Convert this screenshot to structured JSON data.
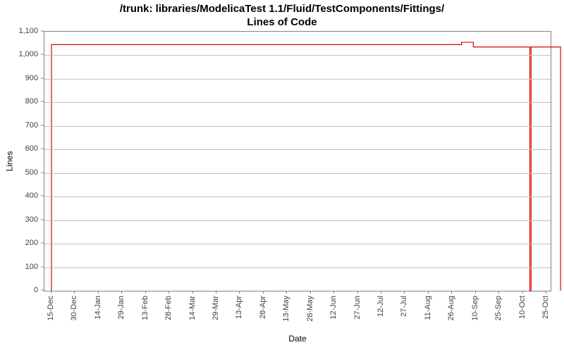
{
  "chart_data": {
    "type": "line",
    "title_line1": "/trunk: libraries/ModelicaTest 1.1/Fluid/TestComponents/Fittings/",
    "title_line2": "Lines of Code",
    "xlabel": "Date",
    "ylabel": "Lines",
    "ylim": [
      0,
      1100
    ],
    "y_ticks": [
      0,
      100,
      200,
      300,
      400,
      500,
      600,
      700,
      800,
      900,
      1000,
      1100
    ],
    "y_tick_labels": [
      "0",
      "100",
      "200",
      "300",
      "400",
      "500",
      "600",
      "700",
      "800",
      "900",
      "1,000",
      "1,100"
    ],
    "x_categories": [
      "15-Dec",
      "30-Dec",
      "14-Jan",
      "29-Jan",
      "13-Feb",
      "28-Feb",
      "14-Mar",
      "29-Mar",
      "13-Apr",
      "28-Apr",
      "13-May",
      "28-May",
      "12-Jun",
      "27-Jun",
      "12-Jul",
      "27-Jul",
      "11-Aug",
      "26-Aug",
      "10-Sep",
      "25-Sep",
      "10-Oct",
      "25-Oct"
    ],
    "series": [
      {
        "name": "Lines of Code",
        "color": "#e00000",
        "points": [
          {
            "xi": 0.0,
            "y": 0
          },
          {
            "xi": 0.0,
            "y": 1045
          },
          {
            "xi": 17.4,
            "y": 1045
          },
          {
            "xi": 17.4,
            "y": 1055
          },
          {
            "xi": 17.9,
            "y": 1055
          },
          {
            "xi": 17.9,
            "y": 1035
          },
          {
            "xi": 20.3,
            "y": 1035
          },
          {
            "xi": 20.3,
            "y": 0
          },
          {
            "xi": 20.35,
            "y": 0
          },
          {
            "xi": 20.35,
            "y": 1035
          },
          {
            "xi": 21.6,
            "y": 1035
          },
          {
            "xi": 21.6,
            "y": 0
          }
        ]
      }
    ]
  }
}
